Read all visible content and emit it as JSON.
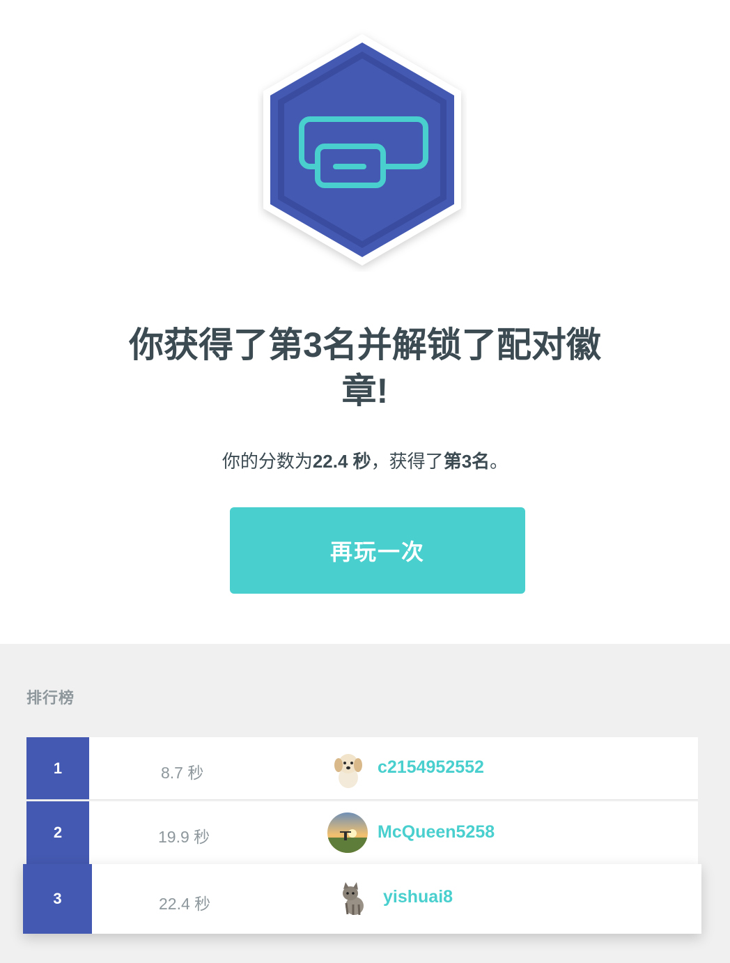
{
  "badge": {
    "icon": "pairing-badge-icon",
    "colors": {
      "outer": "#4459b1",
      "inner": "#3a4ca0",
      "glyph": "#48cfce",
      "frame": "#ffffff"
    }
  },
  "headline": {
    "line1": "你获得了第3名并解锁了配对徽",
    "line2": "章!"
  },
  "score": {
    "prefix": "你的分数为",
    "value": "22.4 秒",
    "middle": "，获得了",
    "rank": "第3名",
    "suffix": "。"
  },
  "play_again_label": "再玩一次",
  "leaderboard": {
    "title": "排行榜",
    "rows": [
      {
        "rank": "1",
        "time": "8.7 秒",
        "name": "c2154952552",
        "avatar": "puppy-avatar"
      },
      {
        "rank": "2",
        "time": "19.9 秒",
        "name": "McQueen5258",
        "avatar": "sunset-avatar"
      },
      {
        "rank": "3",
        "time": "22.4 秒",
        "name": "yishuai8",
        "avatar": "kitten-avatar"
      }
    ]
  },
  "colors": {
    "accent": "#48cfce",
    "rank_bg": "#4459b1",
    "text_dark": "#3c4a52",
    "text_muted": "#8d979c",
    "panel_bg": "#f0f0f0"
  }
}
